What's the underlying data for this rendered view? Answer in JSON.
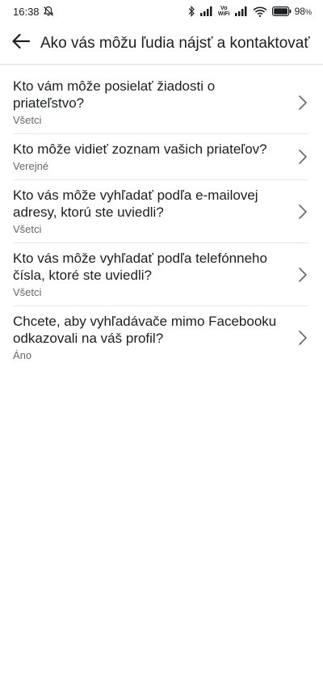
{
  "status_bar": {
    "time": "16:38",
    "battery": "98",
    "battery_unit": "%",
    "vowifi_top": "Vo",
    "vowifi_bottom": "WiFi",
    "icons": [
      "mute-notifications-icon",
      "bluetooth-icon",
      "signal-icon",
      "vowifi-icon",
      "signal-icon",
      "wifi-icon",
      "battery-icon"
    ]
  },
  "header": {
    "back_icon": "back-arrow-icon",
    "title": "Ako vás môžu ľudia nájsť a kontaktovať"
  },
  "settings": [
    {
      "title": "Kto vám môže posielať žiadosti o priateľstvo?",
      "value": "Všetci"
    },
    {
      "title": "Kto môže vidieť zoznam vašich priateľov?",
      "value": "Verejné"
    },
    {
      "title": "Kto vás môže vyhľadať podľa e-mailovej adresy, ktorú ste uviedli?",
      "value": "Všetci"
    },
    {
      "title": "Kto vás môže vyhľadať podľa telefónneho čísla, ktoré ste uviedli?",
      "value": "Všetci"
    },
    {
      "title": "Chcete, aby vyhľadávače mimo Facebooku odkazovali na váš profil?",
      "value": "Áno"
    }
  ],
  "colors": {
    "text_primary": "#1c1e21",
    "text_secondary": "#65676b",
    "divider": "#e4e6eb"
  }
}
